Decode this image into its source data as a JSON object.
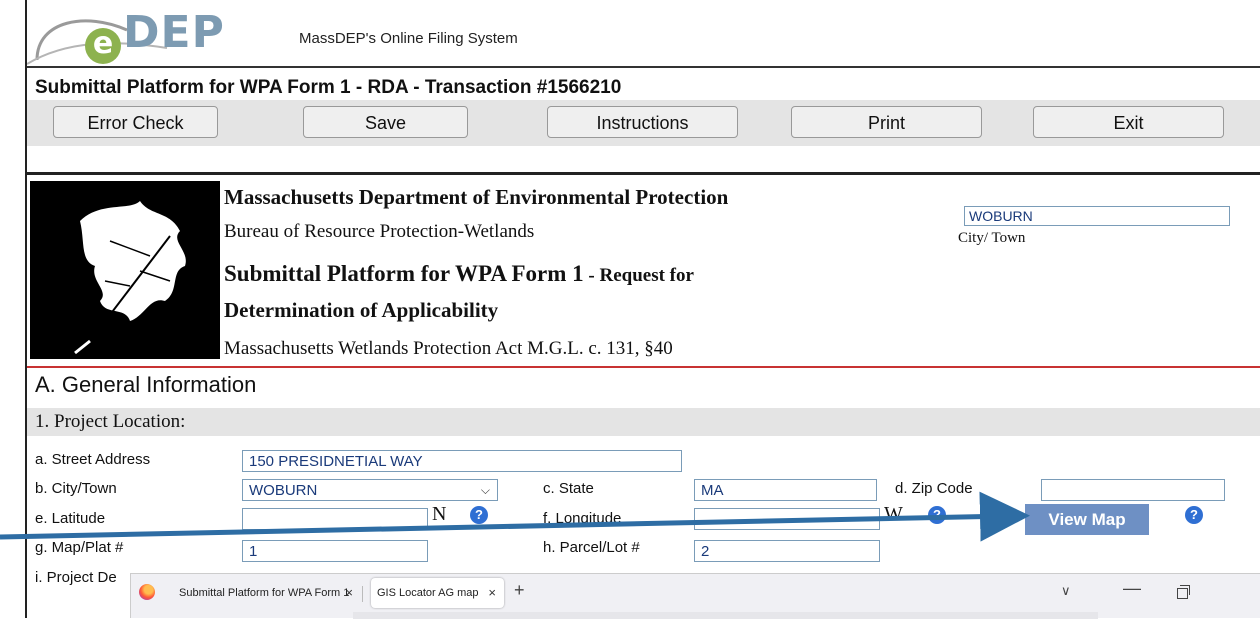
{
  "header": {
    "logo_letter": "e",
    "logo_text": "DEP",
    "system_title": "MassDEP's Online Filing System"
  },
  "submittal_title": "Submittal Platform for WPA Form 1 - RDA - Transaction #1566210",
  "toolbar": {
    "error_check": "Error Check",
    "save": "Save",
    "instructions": "Instructions",
    "print": "Print",
    "exit": "Exit"
  },
  "form_header": {
    "department": "Massachusetts Department of Environmental Protection",
    "bureau": "Bureau of Resource Protection-Wetlands",
    "title_main": "Submittal Platform for WPA Form 1",
    "title_suffix": " - Request for",
    "title_line2": "Determination of Applicability",
    "act": "Massachusetts Wetlands Protection Act M.G.L. c. 131, §40",
    "city_value": "WOBURN",
    "city_label": "City/ Town"
  },
  "section_a": {
    "title": "A.  General Information",
    "project_location": "1.  Project Location:"
  },
  "fields": {
    "street_label": "a. Street Address",
    "street_value": "150 PRESIDNETIAL WAY",
    "city_label": "b. City/Town",
    "city_value": "WOBURN",
    "state_label": "c. State",
    "state_value": "MA",
    "zip_label": "d. Zip Code",
    "zip_value": "",
    "lat_label": "e. Latitude",
    "lat_value": "",
    "lat_suffix": "N",
    "lon_label": "f. Longitude",
    "lon_value": "",
    "lon_suffix": "W",
    "map_label": "g. Map/Plat #",
    "map_value": "1",
    "parcel_label": "h. Parcel/Lot #",
    "parcel_value": "2",
    "project_label": "i. Project De",
    "view_map": "View Map",
    "help_glyph": "?"
  },
  "browser": {
    "tab1": "Submittal Platform for WPA Form 1",
    "tab2": "GIS Locator AG map",
    "close_glyph": "×",
    "new_tab_glyph": "+",
    "list_glyph": "∨",
    "minimize_glyph": "—"
  },
  "colors": {
    "accent_blue": "#2f6fd3",
    "view_map_bg": "#6e90c4",
    "logo_green": "#8db24f",
    "separator_red": "#c83232"
  }
}
